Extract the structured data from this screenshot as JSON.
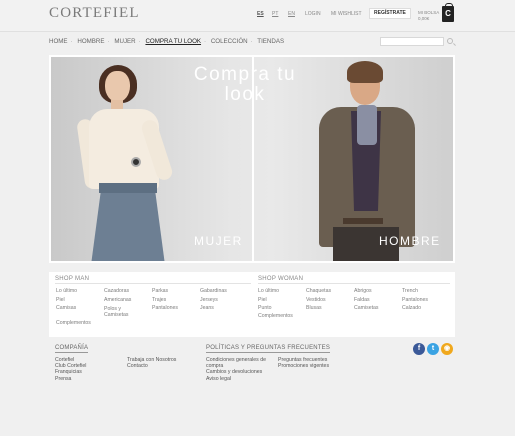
{
  "header": {
    "logo": "CORTEFIEL",
    "languages": [
      "ES",
      "PT",
      "EN"
    ],
    "login": "LOGIN",
    "wishlist": "MI WISHLIST",
    "register": "REGÍSTRATE",
    "bag_line1": "MI BOLSA",
    "bag_line2": "0,00€",
    "bag_icon": "C"
  },
  "breadcrumb": [
    "HOME",
    "HOMBRE",
    "MUJER",
    "COMPRA TU LOOK",
    "COLECCIÓN",
    "TIENDAS"
  ],
  "search": {
    "placeholder": ""
  },
  "hero": {
    "title_line1": "Compra tu",
    "title_line2": "look",
    "left_label": "MUJER",
    "right_label": "HOMBRE"
  },
  "shop_man": {
    "title": "SHOP MAN",
    "col1": [
      "Lo último",
      "Piel",
      "Camisas",
      "",
      "Complementos"
    ],
    "col2": [
      "Cazadoras",
      "Americanas",
      "Polos y",
      "Camisetas"
    ],
    "col3": [
      "Parkas",
      "Trajes",
      "Pantalones"
    ],
    "col4": [
      "Gabardinas",
      "Jerseys",
      "Jeans"
    ]
  },
  "shop_woman": {
    "title": "SHOP WOMAN",
    "col1": [
      "Lo último",
      "Piel",
      "Punto",
      "Complementos"
    ],
    "col2": [
      "Chaquetas",
      "Vestidos",
      "Blusas"
    ],
    "col3": [
      "Abrigos",
      "Faldas",
      "Camisetas"
    ],
    "col4": [
      "Trench",
      "Pantalones",
      "Calzado"
    ]
  },
  "footer": {
    "company_title": "COMPAÑÍA",
    "company_col1": [
      "Cortefiel",
      "Club Cortefiel",
      "Franquicias",
      "Prensa"
    ],
    "company_col2": [
      "Trabaja con Nosotros",
      "Contacto"
    ],
    "policies_title": "POLÍTICAS Y PREGUNTAS FRECUENTES",
    "policies_col1": [
      "Condiciones generales de",
      "compra",
      "Cambios y devoluciones",
      "Aviso legal"
    ],
    "policies_col2": [
      "Preguntas frecuentes",
      "Promociones vigentes"
    ],
    "social": [
      {
        "name": "facebook-icon",
        "glyph": "f",
        "color": "#3b5998"
      },
      {
        "name": "twitter-icon",
        "glyph": "t",
        "color": "#3aa3e3"
      },
      {
        "name": "rss-icon",
        "glyph": "◉",
        "color": "#f0a81d"
      }
    ]
  }
}
